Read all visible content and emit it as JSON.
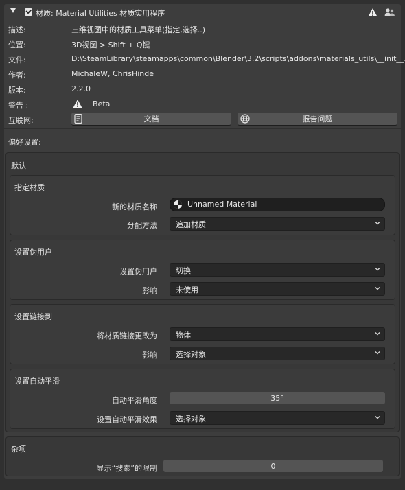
{
  "addon": {
    "header_title": "材质: Material Utilities  材质实用程序",
    "enabled": true,
    "info": [
      {
        "label": "描述:",
        "value": "三维视图中的材质工具菜单(指定,选择..)"
      },
      {
        "label": "位置:",
        "value": "3D视图 > Shift + Q键"
      },
      {
        "label": "文件:",
        "value": "D:\\SteamLibrary\\steamapps\\common\\Blender\\3.2\\scripts\\addons\\materials_utils\\__init__.py"
      },
      {
        "label": "作者:",
        "value": "MichaleW, ChrisHinde"
      },
      {
        "label": "版本:",
        "value": "2.2.0"
      },
      {
        "label": "警告 :",
        "value": "Beta"
      },
      {
        "label": "互联网:",
        "value": ""
      }
    ],
    "docs_button": "文档",
    "report_button": "报告问题"
  },
  "prefs": {
    "title": "偏好设置:",
    "default_panel": {
      "title": "默认",
      "assign_material": {
        "title": "指定材质",
        "new_material_name_label": "新的材质名称",
        "new_material_name_value": "Unnamed Material",
        "assign_method_label": "分配方法",
        "assign_method_value": "追加材质"
      },
      "fake_user": {
        "title": "设置伪用户",
        "fake_user_label": "设置伪用户",
        "fake_user_value": "切换",
        "affect_label": "影响",
        "affect_value": "未使用"
      },
      "link_to": {
        "title": "设置链接到",
        "link_label": "将材质链接更改为",
        "link_value": "物体",
        "affect_label": "影响",
        "affect_value": "选择对象"
      },
      "auto_smooth": {
        "title": "设置自动平滑",
        "angle_label": "自动平滑角度",
        "angle_value": "35°",
        "effect_label": "设置自动平滑效果",
        "effect_value": "选择对象"
      }
    },
    "misc_panel": {
      "title": "杂项",
      "search_limit_label": "显示“搜索”的限制",
      "search_limit_value": "0"
    }
  },
  "colors": {
    "background": "#303030",
    "panel": "#3d3d3d",
    "field": "#282828",
    "button": "#545454"
  }
}
